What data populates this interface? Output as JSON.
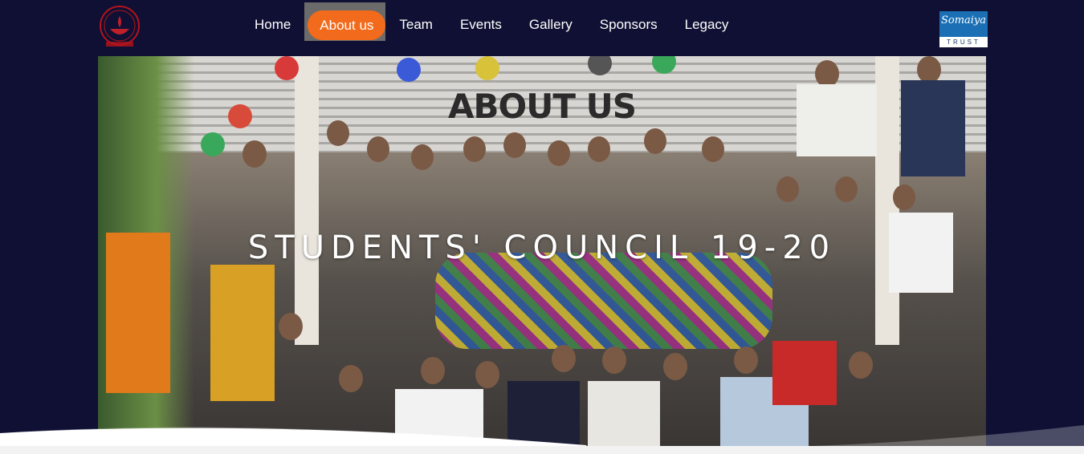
{
  "nav": {
    "items": [
      {
        "label": "Home"
      },
      {
        "label": "About us"
      },
      {
        "label": "Team"
      },
      {
        "label": "Events"
      },
      {
        "label": "Gallery"
      },
      {
        "label": "Sponsors"
      },
      {
        "label": "Legacy"
      }
    ],
    "active_index": 1
  },
  "logos": {
    "left_icon": "somaiya-vidyavihar-logo",
    "right_text": "Somaiya",
    "right_band": "TRUST"
  },
  "hero": {
    "title": "ABOUT US",
    "subtitle": "STUDENTS' COUNCIL 19-20"
  },
  "colors": {
    "navbar": "#0f1033",
    "active_pill": "#f26a1b",
    "active_bg": "#6b6b6b",
    "text": "#ffffff"
  }
}
